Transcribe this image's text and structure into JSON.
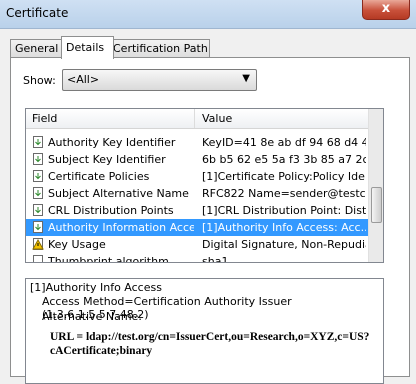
{
  "window": {
    "title": "Certificate",
    "close_label": "x"
  },
  "tabs": [
    {
      "label": "General"
    },
    {
      "label": "Details"
    },
    {
      "label": "Certification Path"
    }
  ],
  "show": {
    "label": "Show:",
    "value": "<All>"
  },
  "list": {
    "headers": {
      "field": "Field",
      "value": "Value"
    },
    "rows": [
      {
        "field": "Authority Key Identifier",
        "value": "KeyID=41 8e ab df 94 68 d4 4...",
        "icon": "document-down-icon"
      },
      {
        "field": "Subject Key Identifier",
        "value": "6b b5 62 e5 5a f3 3b 85 a7 2c ...",
        "icon": "document-down-icon"
      },
      {
        "field": "Certificate Policies",
        "value": "[1]Certificate Policy:Policy Ide...",
        "icon": "document-down-icon"
      },
      {
        "field": "Subject Alternative Name",
        "value": "RFC822 Name=sender@testc...",
        "icon": "document-down-icon"
      },
      {
        "field": "CRL Distribution Points",
        "value": "[1]CRL Distribution Point: Distr...",
        "icon": "document-down-icon"
      },
      {
        "field": "Authority Information Access",
        "value": "[1]Authority Info Access: Acc...",
        "icon": "document-down-icon",
        "selected": true
      },
      {
        "field": "Key Usage",
        "value": "Digital Signature, Non-Repudia...",
        "icon": "warning-document-icon"
      },
      {
        "field": "Thumbprint algorithm",
        "value": "sha1",
        "icon": "document-icon"
      }
    ]
  },
  "details": {
    "title": "[1]Authority Info Access",
    "method": "Access Method=Certification Authority Issuer (1.3.6.1.5.5.7.48.2)",
    "alt": "Alternative Name:",
    "url": "URL = ldap://test.org/cn=IssuerCert,ou=Research,o=XYZ,c=US?cACertificate;binary"
  },
  "colors": {
    "selection": "#3399ff",
    "title_bar": "#b9d1ea",
    "close_button": "#c8503a"
  }
}
